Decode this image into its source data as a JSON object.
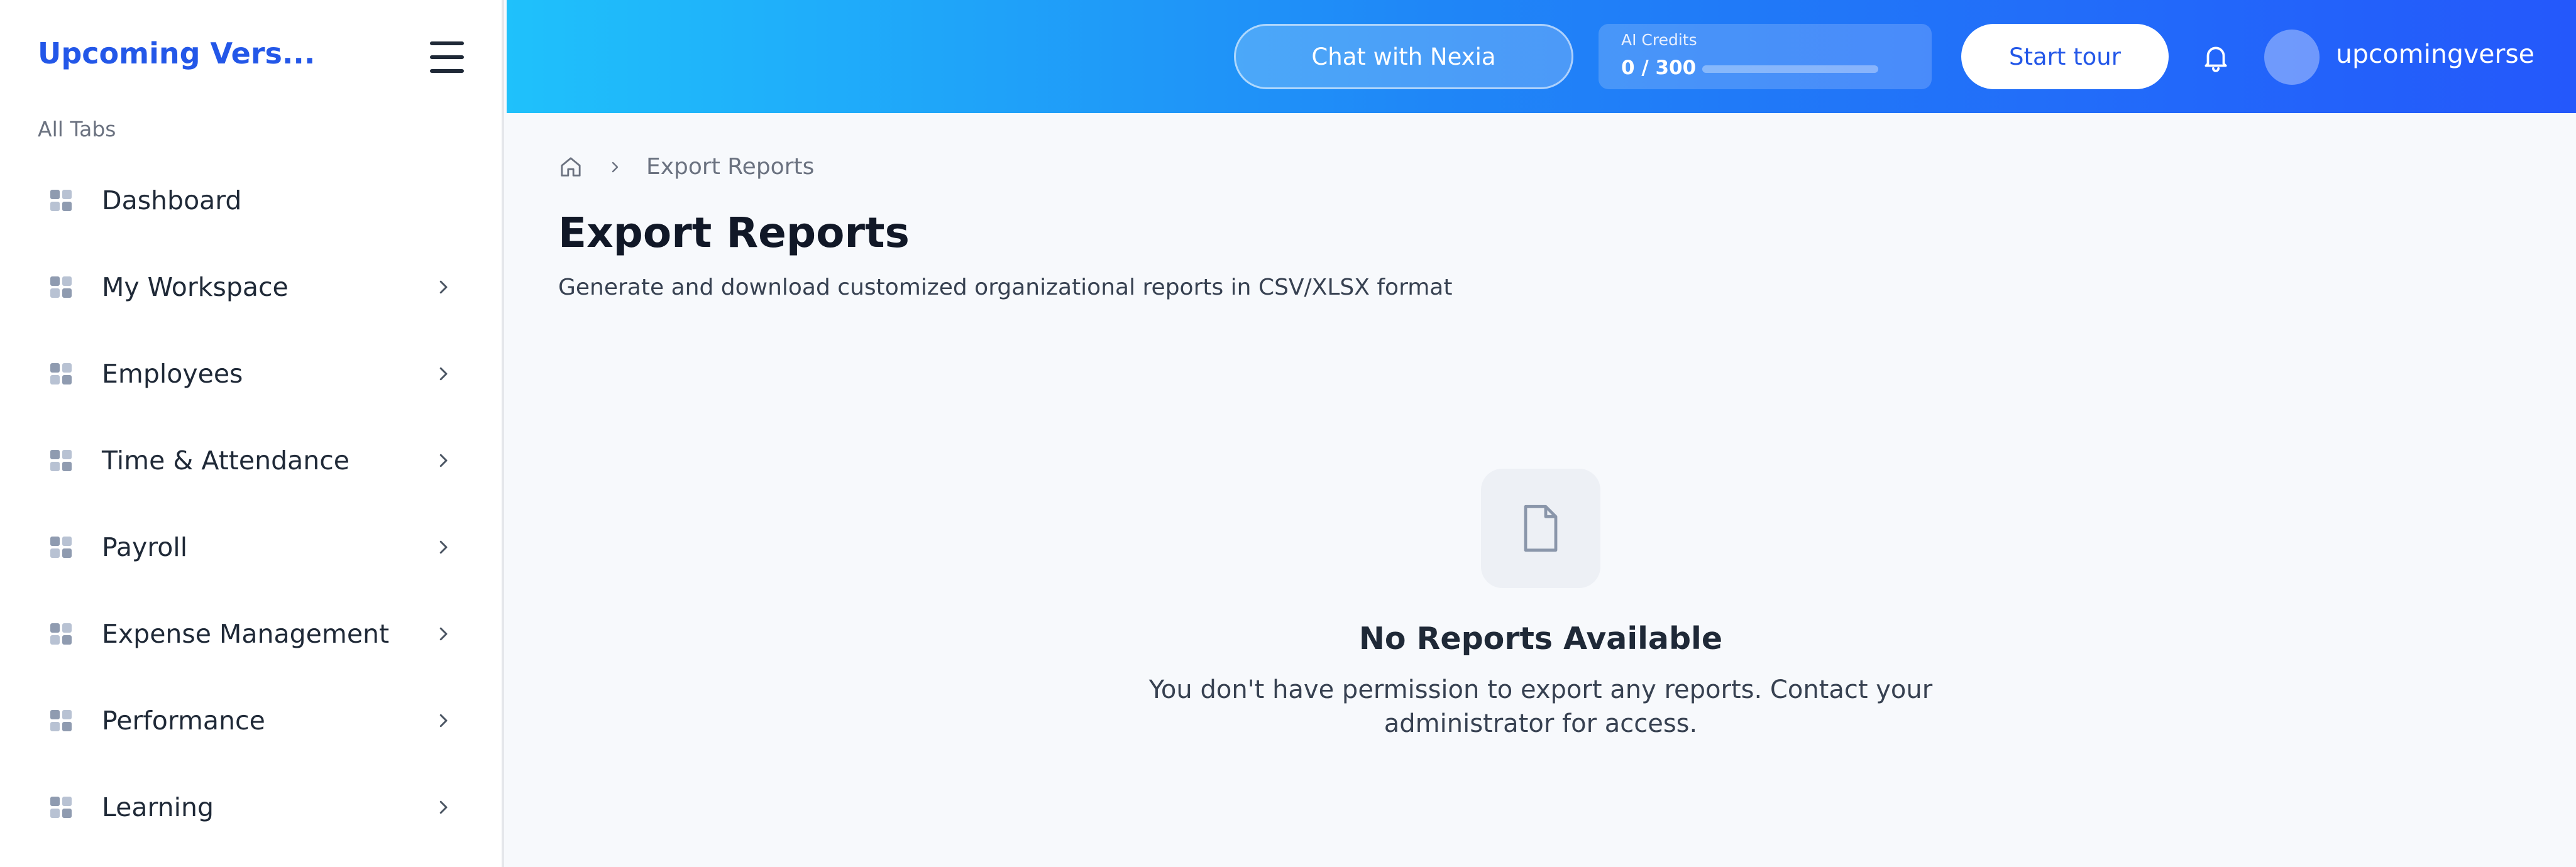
{
  "sidebar": {
    "brand": "Upcoming Vers...",
    "section_label": "All Tabs",
    "items": [
      {
        "label": "Dashboard"
      },
      {
        "label": "My Workspace"
      },
      {
        "label": "Employees"
      },
      {
        "label": "Time & Attendance"
      },
      {
        "label": "Payroll"
      },
      {
        "label": "Expense Management"
      },
      {
        "label": "Performance"
      },
      {
        "label": "Learning"
      }
    ]
  },
  "header": {
    "chat_label": "Chat with Nexia",
    "credits": {
      "title": "AI Credits",
      "value": "0 / 300",
      "used": 0,
      "total": 300
    },
    "tour_label": "Start tour",
    "username": "upcomingverse"
  },
  "main": {
    "breadcrumb": "Export Reports",
    "title": "Export Reports",
    "subtitle": "Generate and download customized organizational reports in CSV/XLSX format",
    "empty_title": "No Reports Available",
    "empty_text": "You don't have permission to export any reports. Contact your administrator for access."
  },
  "colors": {
    "brand": "#2357e8",
    "header_gradient_start": "#1fc1fb",
    "header_gradient_end": "#2458fb",
    "background": "#f7f9fc"
  },
  "icons": {
    "nav": "grid-icon",
    "menu": "hamburger-icon",
    "chevron": "chevron-right-icon",
    "home": "home-icon",
    "bell": "bell-icon",
    "empty_state": "document-icon"
  }
}
